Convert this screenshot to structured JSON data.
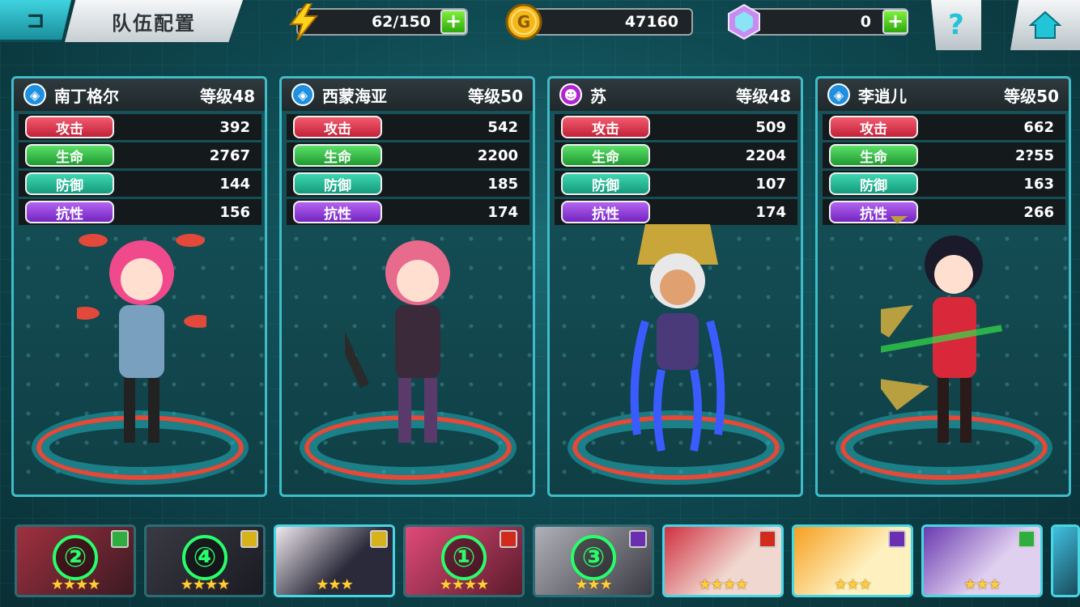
{
  "header": {
    "title": "队伍配置",
    "energy": "62/150",
    "gold": "47160",
    "gems": "0",
    "help_glyph": "?"
  },
  "icons": {
    "back": "back-arrow-icon",
    "energy": "lightning-icon",
    "gold": "gold-coin-icon",
    "gem": "gem-icon",
    "help": "question-icon",
    "home": "home-icon"
  },
  "colors": {
    "accent": "#3fbcc8",
    "attack": "#c22138",
    "hp": "#1f9a30",
    "defense": "#159a7c",
    "resist": "#7424c0",
    "plus": "#2ea80e"
  },
  "stat_labels": {
    "atk": "攻击",
    "hp": "生命",
    "def": "防御",
    "res": "抗性"
  },
  "heroes": [
    {
      "name": "南丁格尔",
      "level": "等级48",
      "attr_icon": "water-shield-icon",
      "attr_color": "#1f8fe0",
      "atk": "392",
      "hp": "2767",
      "def": "144",
      "res": "156"
    },
    {
      "name": "西蒙海亚",
      "level": "等级50",
      "attr_icon": "water-shield-icon",
      "attr_color": "#1f8fe0",
      "atk": "542",
      "hp": "2200",
      "def": "185",
      "res": "174"
    },
    {
      "name": "苏",
      "level": "等级48",
      "attr_icon": "dark-skull-icon",
      "attr_color": "#b226d0",
      "atk": "509",
      "hp": "2204",
      "def": "107",
      "res": "174"
    },
    {
      "name": "李逍儿",
      "level": "等级50",
      "attr_icon": "water-shield-icon",
      "attr_color": "#1f8fe0",
      "atk": "662",
      "hp": "2?55",
      "def": "163",
      "res": "266"
    }
  ],
  "roster": [
    {
      "order": "②",
      "stars": "★★★★",
      "element": "wind-element-icon",
      "elem_color": "#2fae3f"
    },
    {
      "order": "④",
      "stars": "★★★★",
      "element": "light-element-icon",
      "elem_color": "#d8b21a"
    },
    {
      "order": "",
      "stars": "★★★",
      "element": "light-element-icon",
      "elem_color": "#d8b21a"
    },
    {
      "order": "①",
      "stars": "★★★★",
      "element": "fire-element-icon",
      "elem_color": "#d22a1c"
    },
    {
      "order": "③",
      "stars": "★★★",
      "element": "dark-element-icon",
      "elem_color": "#6a2fb0"
    },
    {
      "order": "",
      "stars": "★★★★",
      "element": "fire-element-icon",
      "elem_color": "#d22a1c"
    },
    {
      "order": "",
      "stars": "★★★",
      "element": "dark-element-icon",
      "elem_color": "#6a2fb0"
    },
    {
      "order": "",
      "stars": "★★★",
      "element": "wind-element-icon",
      "elem_color": "#2fae3f"
    }
  ]
}
